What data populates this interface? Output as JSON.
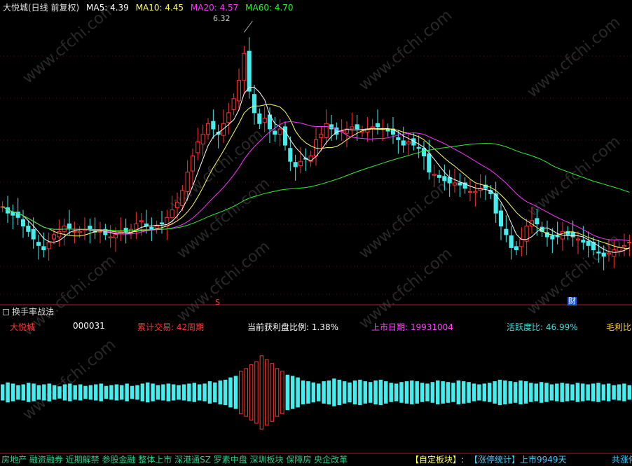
{
  "header": {
    "title": "大悦城(日线 前复权)",
    "ma5": "MA5: 4.39",
    "ma10": "MA10: 4.45",
    "ma20": "MA20: 4.57",
    "ma60": "MA60: 4.70",
    "colors": {
      "title": "#e0e0e0",
      "ma5": "#ffffff",
      "ma10": "#ffff66",
      "ma20": "#ff33ff",
      "ma60": "#33ee33"
    }
  },
  "annotations": {
    "high_price": "6.32",
    "event_s": "S",
    "event_cai": "财"
  },
  "indicator": {
    "title": "换手率战法",
    "stock_name": "大悦城",
    "code": "000031",
    "cum_trade": "累计交易: 42周期",
    "profit_ratio": "当前获利盘比例: 1.38%",
    "listing_date": "上市日期: 19931004",
    "activity_ratio": "活跃度比: 46.99%",
    "gross_margin": "毛利比"
  },
  "footer": {
    "tags": "房地产 融资融券 近期解禁 参股金融 整体上市 深港通SZ 罗素中盘 深圳板块 保障房 央企改革",
    "custom_block": "【自定板块】:",
    "limit_stats": "【涨停统计】上市9949天",
    "total_limit": "共涨停"
  },
  "chart_data": {
    "type": "candlestick",
    "close": [
      4.78,
      4.72,
      4.7,
      4.68,
      4.6,
      4.55,
      4.48,
      4.42,
      4.38,
      4.45,
      4.52,
      4.55,
      4.6,
      4.58,
      4.55,
      4.55,
      4.57,
      4.57,
      4.55,
      4.55,
      4.52,
      4.5,
      4.52,
      4.55,
      4.55,
      4.57,
      4.62,
      4.65,
      4.6,
      4.57,
      4.6,
      4.62,
      4.68,
      4.75,
      4.82,
      4.93,
      5.1,
      5.25,
      5.38,
      5.45,
      5.55,
      5.5,
      5.45,
      5.55,
      5.65,
      5.78,
      5.95,
      6.2,
      5.85,
      5.65,
      5.55,
      5.6,
      5.5,
      5.45,
      5.5,
      5.35,
      5.2,
      5.15,
      5.2,
      5.22,
      5.25,
      5.4,
      5.45,
      5.55,
      5.5,
      5.45,
      5.48,
      5.5,
      5.52,
      5.5,
      5.48,
      5.5,
      5.52,
      5.52,
      5.5,
      5.48,
      5.45,
      5.4,
      5.35,
      5.38,
      5.35,
      5.32,
      5.25,
      5.1,
      5.08,
      5.05,
      5.02,
      5.0,
      5.0,
      4.98,
      4.95,
      4.92,
      4.92,
      4.95,
      4.95,
      4.9,
      4.72,
      4.6,
      4.52,
      4.4,
      4.38,
      4.48,
      4.6,
      4.65,
      4.62,
      4.55,
      4.5,
      4.48,
      4.5,
      4.55,
      4.52,
      4.5,
      4.48,
      4.45,
      4.42,
      4.38,
      4.35,
      4.32,
      4.35,
      4.38,
      4.4,
      4.42,
      4.45
    ],
    "yrange": [
      4.0,
      6.5
    ],
    "series": [
      {
        "name": "MA5",
        "color": "#ffffff"
      },
      {
        "name": "MA10",
        "color": "#ffff66"
      },
      {
        "name": "MA20",
        "color": "#ff33ff"
      },
      {
        "name": "MA60",
        "color": "#33ee33"
      }
    ],
    "turnover": [
      0.2,
      0.25,
      0.22,
      0.18,
      0.2,
      0.24,
      0.22,
      0.18,
      0.2,
      0.22,
      0.18,
      0.15,
      0.2,
      0.22,
      0.18,
      0.2,
      0.16,
      0.18,
      0.2,
      0.22,
      0.16,
      0.18,
      0.2,
      0.18,
      0.22,
      0.16,
      0.18,
      0.22,
      0.25,
      0.22,
      0.18,
      0.2,
      0.22,
      0.2,
      0.18,
      0.2,
      0.22,
      0.24,
      0.2,
      0.22,
      0.28,
      0.25,
      0.3,
      0.32,
      0.38,
      0.42,
      0.55,
      0.62,
      0.72,
      0.8,
      0.95,
      0.85,
      0.75,
      0.62,
      0.55,
      0.45,
      0.42,
      0.38,
      0.3,
      0.28,
      0.25,
      0.22,
      0.28,
      0.3,
      0.35,
      0.32,
      0.28,
      0.25,
      0.3,
      0.32,
      0.28,
      0.26,
      0.3,
      0.32,
      0.28,
      0.24,
      0.22,
      0.26,
      0.28,
      0.3,
      0.28,
      0.24,
      0.22,
      0.26,
      0.3,
      0.28,
      0.26,
      0.24,
      0.3,
      0.28,
      0.26,
      0.22,
      0.2,
      0.22,
      0.24,
      0.28,
      0.32,
      0.3,
      0.28,
      0.26,
      0.3,
      0.28,
      0.24,
      0.22,
      0.26,
      0.24,
      0.2,
      0.22,
      0.24,
      0.22,
      0.2,
      0.24,
      0.22,
      0.2,
      0.22,
      0.24,
      0.2,
      0.22,
      0.18,
      0.2,
      0.22,
      0.18
    ]
  },
  "watermark": "www.cfchi.com"
}
